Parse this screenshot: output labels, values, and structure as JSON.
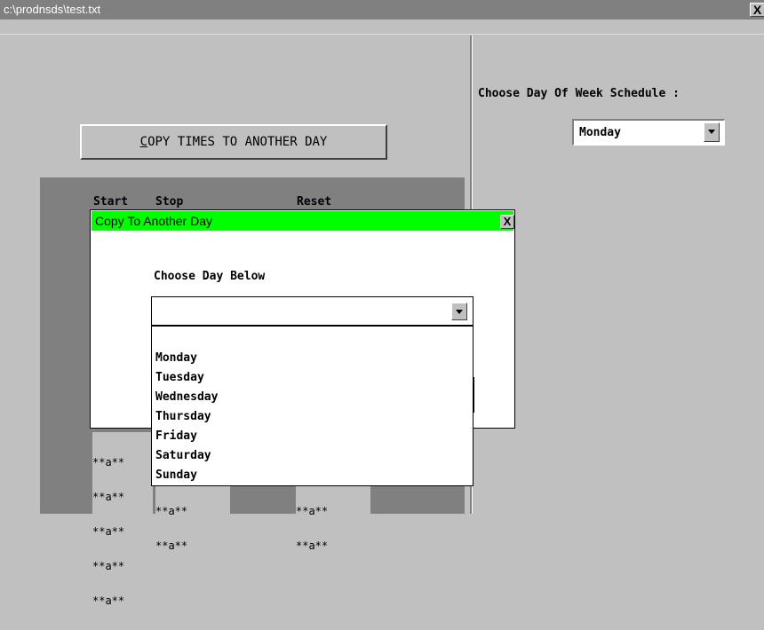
{
  "window": {
    "title": "c:\\prodnsds\\test.txt",
    "close_glyph": "X"
  },
  "main": {
    "copy_button": {
      "underlined": "C",
      "rest": "OPY TIMES TO ANOTHER DAY"
    },
    "schedule_label": "Choose Day Of Week Schedule :",
    "schedule_select_value": "Monday"
  },
  "grid": {
    "headers": [
      "Start",
      "Stop",
      "Reset"
    ],
    "start_values": [
      "**a**",
      "**a**",
      "**a**",
      "**a**",
      "**a**"
    ],
    "stop_values": [
      "**a**",
      "**a**"
    ],
    "reset_values": [
      "**a**",
      "**a**"
    ]
  },
  "dialog": {
    "title": "Copy To Another Day",
    "close_glyph": "X",
    "prompt": "Choose Day Below",
    "select_value": "",
    "options": [
      "Monday",
      "Tuesday",
      "Wednesday",
      "Thursday",
      "Friday",
      "Saturday",
      "Sunday"
    ]
  },
  "colors": {
    "dialog_title_bg": "#00ff00",
    "window_title_bg": "#808080",
    "panel_bg": "#c0c0c0",
    "grid_bg": "#808080"
  }
}
